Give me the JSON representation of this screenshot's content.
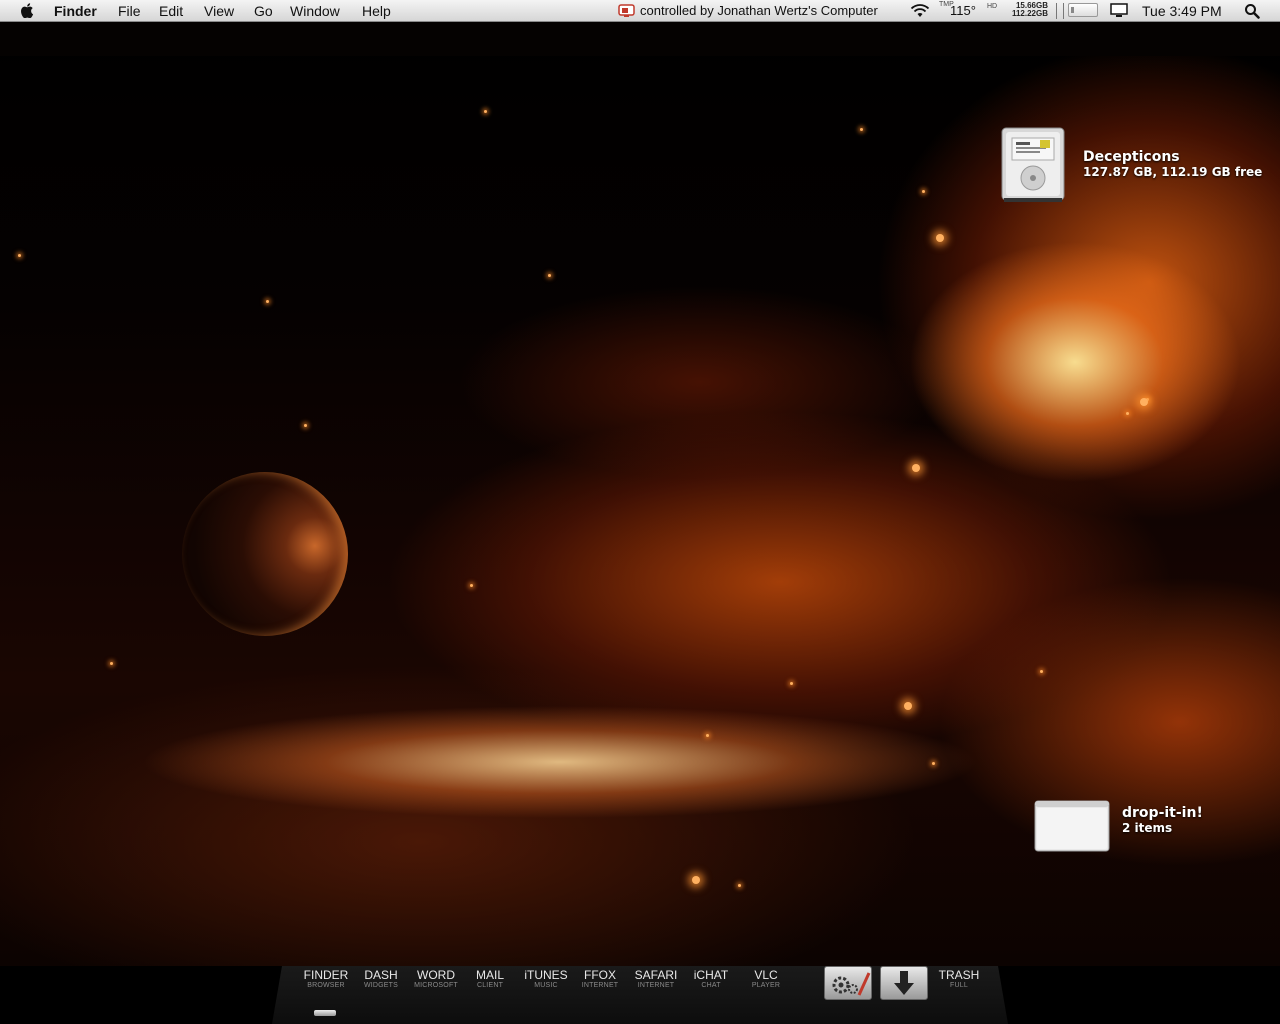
{
  "menubar": {
    "app_name": "Finder",
    "menus": [
      "File",
      "Edit",
      "View",
      "Go",
      "Window",
      "Help"
    ],
    "remote_status": "controlled by Jonathan Wertz's Computer",
    "temp_label": "TMP",
    "temperature": "115°",
    "disk_label": "HD",
    "disk_stats": [
      "15.66GB",
      "112.22GB"
    ],
    "clock": "Tue 3:49 PM",
    "icons": [
      "apple-icon",
      "remote-control-icon",
      "wifi-icon",
      "battery-icon",
      "display-icon",
      "spotlight-icon"
    ]
  },
  "desktop": {
    "drive": {
      "name": "Decepticons",
      "info": "127.87 GB, 112.19 GB free"
    },
    "folder": {
      "name": "drop-it-in!",
      "info": "2 items"
    }
  },
  "dock": {
    "items": [
      {
        "title": "FINDER",
        "subtitle": "BROWSER"
      },
      {
        "title": "DASH",
        "subtitle": "WIDGETS"
      },
      {
        "title": "WORD",
        "subtitle": "MICROSOFT"
      },
      {
        "title": "MAIL",
        "subtitle": "CLIENT"
      },
      {
        "title": "iTUNES",
        "subtitle": "MUSIC"
      },
      {
        "title": "FFOX",
        "subtitle": "INTERNET"
      },
      {
        "title": "SAFARI",
        "subtitle": "INTERNET"
      },
      {
        "title": "iCHAT",
        "subtitle": "CHAT"
      },
      {
        "title": "VLC",
        "subtitle": "PLAYER"
      }
    ],
    "stacks": [
      "applications-stack-icon",
      "downloads-stack-icon"
    ],
    "trash": {
      "title": "TRASH",
      "subtitle": "FULL"
    }
  }
}
